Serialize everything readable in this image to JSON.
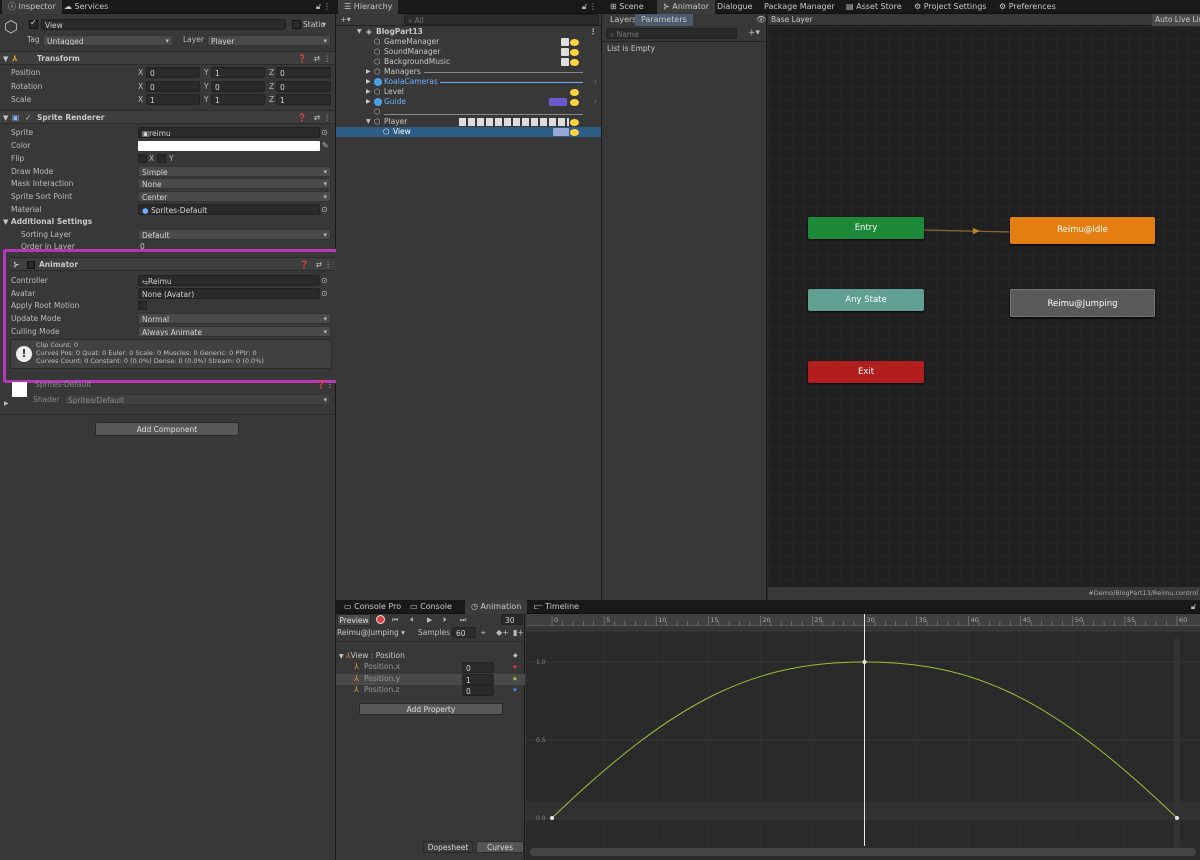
{
  "inspector": {
    "tabs": [
      "Inspector",
      "Services"
    ],
    "object_name": "View",
    "static_label": "Static",
    "tag_label": "Tag",
    "tag_value": "Untagged",
    "layer_label": "Layer",
    "layer_value": "Player",
    "transform": {
      "title": "Transform",
      "position": {
        "label": "Position",
        "x": "0",
        "y": "1",
        "z": "0"
      },
      "rotation": {
        "label": "Rotation",
        "x": "0",
        "y": "0",
        "z": "0"
      },
      "scale": {
        "label": "Scale",
        "x": "1",
        "y": "1",
        "z": "1"
      }
    },
    "sprite_renderer": {
      "title": "Sprite Renderer",
      "sprite_label": "Sprite",
      "sprite_value": "reimu",
      "color_label": "Color",
      "flip_label": "Flip",
      "flip_x": "X",
      "flip_y": "Y",
      "draw_mode_label": "Draw Mode",
      "draw_mode_value": "Simple",
      "mask_label": "Mask Interaction",
      "mask_value": "None",
      "sort_point_label": "Sprite Sort Point",
      "sort_point_value": "Center",
      "material_label": "Material",
      "material_value": "Sprites-Default",
      "additional_label": "Additional Settings",
      "sorting_layer_label": "Sorting Layer",
      "sorting_layer_value": "Default",
      "order_label": "Order in Layer",
      "order_value": "0"
    },
    "animator": {
      "title": "Animator",
      "controller_label": "Controller",
      "controller_value": "Reimu",
      "avatar_label": "Avatar",
      "avatar_value": "None (Avatar)",
      "root_motion_label": "Apply Root Motion",
      "update_label": "Update Mode",
      "update_value": "Normal",
      "culling_label": "Culling Mode",
      "culling_value": "Always Animate",
      "info_line1": "Clip Count: 0",
      "info_line2": "Curves Pos: 0 Quat: 0 Euler: 0 Scale: 0 Muscles: 0 Generic: 0 PPtr: 0",
      "info_line3": "Curves Count: 0 Constant: 0 (0.0%) Dense: 0 (0.0%) Stream: 0 (0.0%)"
    },
    "material": {
      "name": "Sprites-Default",
      "shader_label": "Shader",
      "shader_value": "Sprites/Default"
    },
    "add_component": "Add Component"
  },
  "hierarchy": {
    "tab": "Hierarchy",
    "search_placeholder": "All",
    "scene": "BlogPart13",
    "items": [
      {
        "label": "GameManager"
      },
      {
        "label": "SoundManager"
      },
      {
        "label": "BackgroundMusic"
      },
      {
        "label": "Managers"
      },
      {
        "label": "KoalaCameras"
      },
      {
        "label": "Level"
      },
      {
        "label": "Guide"
      },
      {
        "label": ""
      },
      {
        "label": "Player"
      },
      {
        "label": "View"
      }
    ]
  },
  "animator_window": {
    "tabs": [
      "Scene",
      "Animator",
      "Dialogue",
      "Package Manager",
      "Asset Store",
      "Project Settings",
      "Preferences"
    ],
    "sub_tabs": [
      "Layers",
      "Parameters"
    ],
    "base_layer": "Base Layer",
    "auto_live": "Auto Live Lin",
    "name_placeholder": "Name",
    "list_empty": "List is Empty",
    "nodes": {
      "entry": "Entry",
      "idle": "Reimu@Idle",
      "any_state": "Any State",
      "jumping": "Reimu@Jumping",
      "exit": "Exit"
    },
    "path": "#Demo/BlogPart13/Reimu.control",
    "colors": {
      "entry": "#1d8a3a",
      "idle": "#e57e11",
      "any_state": "#5fa092",
      "jumping": "#5a5a5a",
      "exit": "#b21d1d"
    }
  },
  "animation": {
    "tabs": [
      "Console Pro",
      "Console",
      "Animation"
    ],
    "timeline_tab": "Timeline",
    "preview": "Preview",
    "frame": "30",
    "clip": "Reimu@Jumping",
    "samples_label": "Samples",
    "samples_value": "60",
    "group": "View : Position",
    "props": [
      {
        "label": "Position.x",
        "value": "0"
      },
      {
        "label": "Position.y",
        "value": "1"
      },
      {
        "label": "Position.z",
        "value": "0"
      }
    ],
    "add_property": "Add Property",
    "ruler": [
      "0",
      "5",
      "10",
      "15",
      "20",
      "25",
      "30",
      "35",
      "40",
      "45",
      "50",
      "55",
      "60"
    ],
    "y_labels": [
      "1.0",
      "0.5",
      "0.0"
    ],
    "bottom_tabs": [
      "Dopesheet",
      "Curves"
    ]
  }
}
